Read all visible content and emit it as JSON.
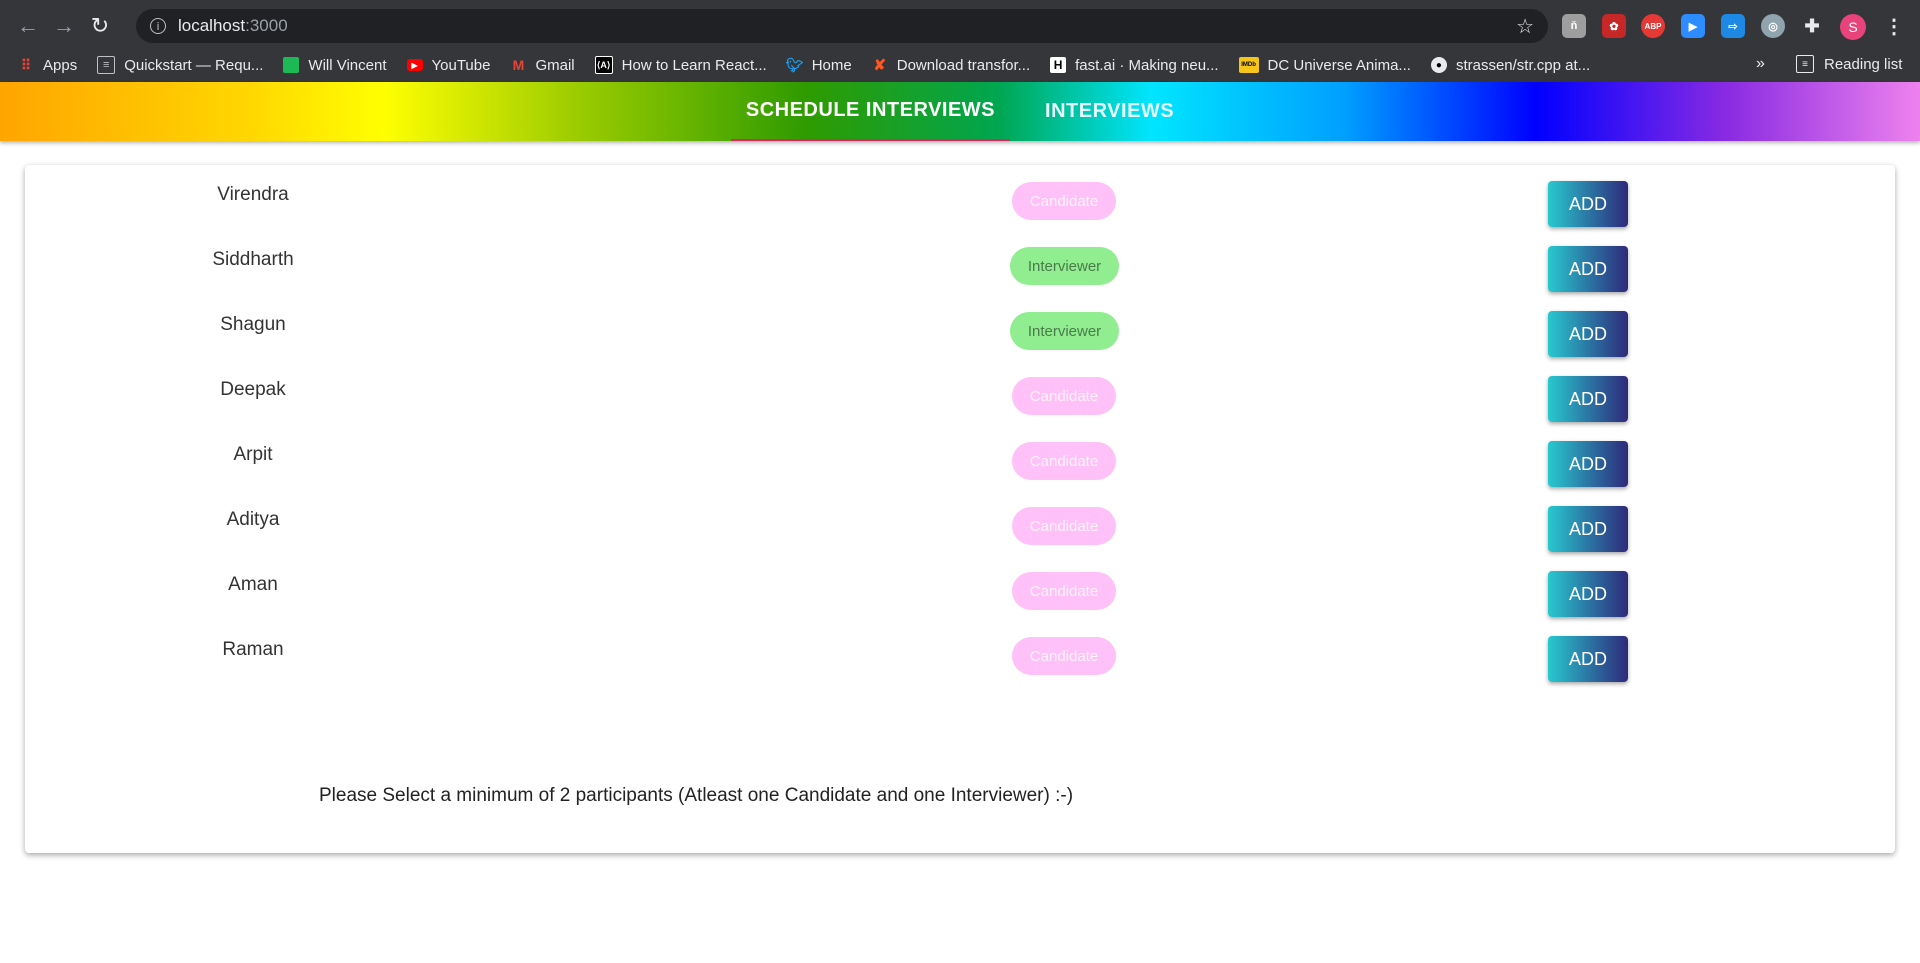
{
  "browser": {
    "url_host": "localhost",
    "url_port": ":3000",
    "profile_initial": "S",
    "bookmarks": [
      {
        "label": "Apps",
        "icon": "apps-grid-icon"
      },
      {
        "label": "Quickstart — Requ...",
        "icon": "quickstart-icon"
      },
      {
        "label": "Will Vincent",
        "icon": "will-vincent-icon"
      },
      {
        "label": "YouTube",
        "icon": "youtube-icon"
      },
      {
        "label": "Gmail",
        "icon": "gmail-icon"
      },
      {
        "label": "How to Learn React...",
        "icon": "react-icon"
      },
      {
        "label": "Home",
        "icon": "twitter-icon"
      },
      {
        "label": "Download transfor...",
        "icon": "x-icon"
      },
      {
        "label": "fast.ai · Making neu...",
        "icon": "hackernews-icon"
      },
      {
        "label": "DC Universe Anima...",
        "icon": "imdb-icon"
      },
      {
        "label": "strassen/str.cpp at...",
        "icon": "github-icon"
      }
    ],
    "more_bookmarks": "»",
    "reading_list": "Reading list",
    "extensions": {
      "abp": "ABP"
    }
  },
  "nav": {
    "tabs": [
      {
        "label": "SCHEDULE INTERVIEWS"
      },
      {
        "label": "INTERVIEWS"
      }
    ]
  },
  "participants": [
    {
      "name": "Virendra",
      "role": "Candidate",
      "action": "ADD"
    },
    {
      "name": "Siddharth",
      "role": "Interviewer",
      "action": "ADD"
    },
    {
      "name": "Shagun",
      "role": "Interviewer",
      "action": "ADD"
    },
    {
      "name": "Deepak",
      "role": "Candidate",
      "action": "ADD"
    },
    {
      "name": "Arpit",
      "role": "Candidate",
      "action": "ADD"
    },
    {
      "name": "Aditya",
      "role": "Candidate",
      "action": "ADD"
    },
    {
      "name": "Aman",
      "role": "Candidate",
      "action": "ADD"
    },
    {
      "name": "Raman",
      "role": "Candidate",
      "action": "ADD"
    }
  ],
  "hint": "Please Select a minimum of 2 participants (Atleast one Candidate and one Interviewer) :-)",
  "colors": {
    "candidate_badge": "#ffc1f7",
    "interviewer_badge": "#90ee90",
    "active_tab_underline": "#e0245e"
  }
}
